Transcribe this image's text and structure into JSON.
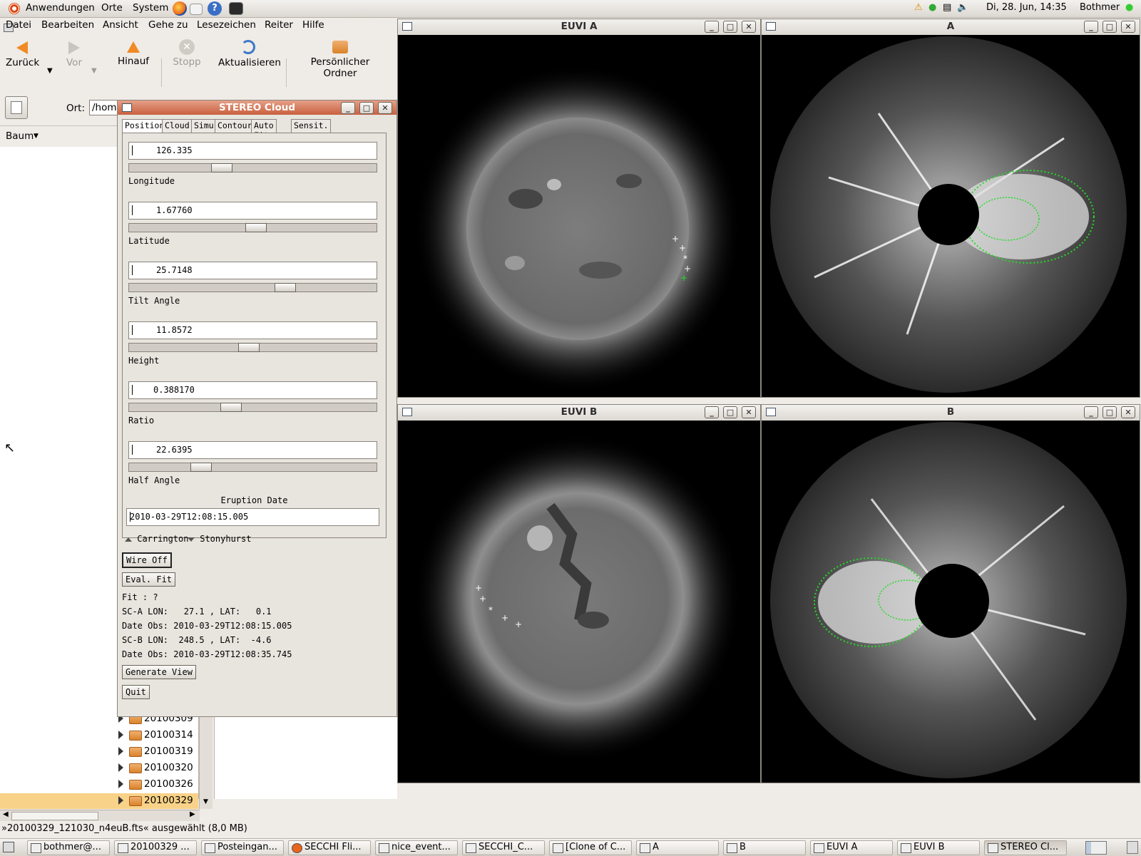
{
  "top_panel": {
    "menus": [
      "Anwendungen",
      "Orte",
      "System"
    ],
    "clock": "Di, 28. Jun, 14:35",
    "user": "Bothmer"
  },
  "file_manager": {
    "menubar": [
      "Datei",
      "Bearbeiten",
      "Ansicht",
      "Gehe zu",
      "Lesezeichen",
      "Reiter",
      "Hilfe"
    ],
    "toolbar": {
      "back": "Zurück",
      "forward": "Vor",
      "up": "Hinauf",
      "stop": "Stopp",
      "reload": "Aktualisieren",
      "home": "Persönlicher Ordner"
    },
    "location_label": "Ort:",
    "location_value": "/hom",
    "sidebar_mode": "Baum",
    "tree_items": [
      "20100309",
      "20100314",
      "20100319",
      "20100320",
      "20100326",
      "20100329"
    ],
    "selected_item": "20100329",
    "status": "»20100329_121030_n4euB.fts« ausgewählt (8,0 MB)"
  },
  "dialog": {
    "title": "STEREO Cloud",
    "tabs": [
      "Position",
      "Cloud",
      "Simu",
      "Contour",
      "Auto Fit",
      "Sensit."
    ],
    "active_tab": "Position",
    "fields": [
      {
        "label": "Longitude",
        "value": "126.335",
        "slider": 0.36
      },
      {
        "label": "Latitude",
        "value": "1.67760",
        "slider": 0.51
      },
      {
        "label": "Tilt Angle",
        "value": "25.7148",
        "slider": 0.64
      },
      {
        "label": "Height",
        "value": "11.8572",
        "slider": 0.48
      },
      {
        "label": "Ratio",
        "value": "0.388170",
        "slider": 0.4
      },
      {
        "label": "Half Angle",
        "value": "22.6395",
        "slider": 0.27
      }
    ],
    "eruption_label": "Eruption Date",
    "eruption_value": "2010-03-29T12:08:15.005",
    "radio_carrington": "Carrington",
    "radio_stonyhurst": "Stonyhurst",
    "wire_button": "Wire Off",
    "eval_button": "Eval. Fit",
    "fit_text": "Fit : ?",
    "sca_lon": "SC-A LON:   27.1 , LAT:   0.1",
    "sca_date": "Date Obs: 2010-03-29T12:08:15.005",
    "scb_lon": "SC-B LON:  248.5 , LAT:  -4.6",
    "scb_date": "Date Obs: 2010-03-29T12:08:35.745",
    "generate_button": "Generate View",
    "quit_button": "Quit"
  },
  "image_windows": {
    "euvi_a": "EUVI A",
    "cor_a": "A",
    "euvi_b": "EUVI B",
    "cor_b": "B"
  },
  "taskbar": [
    "bothmer@...",
    "20100329 ...",
    "Posteingan...",
    "SECCHI Fli...",
    "nice_event...",
    "SECCHI_C...",
    "[Clone of C...",
    "A",
    "B",
    "EUVI A",
    "EUVI B",
    "STEREO Cl..."
  ],
  "colors": {
    "active_title": "#c8603e",
    "selection": "#f8d288",
    "fit_wire": "#22dd22"
  }
}
